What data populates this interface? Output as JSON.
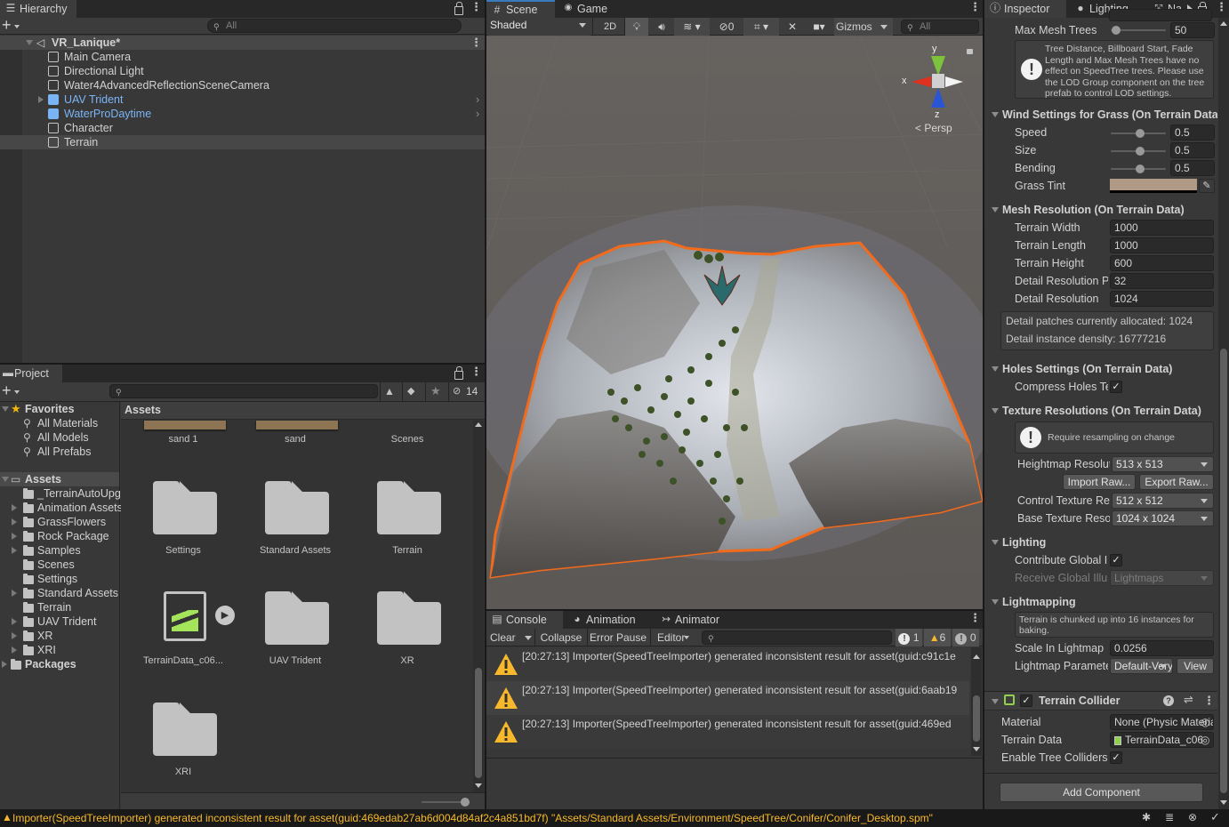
{
  "hierarchy": {
    "tab_label": "Hierarchy",
    "search_placeholder": "All",
    "scene_name": "VR_Lanique*",
    "items": [
      {
        "label": "Main Camera",
        "prefab": false,
        "expandable": false
      },
      {
        "label": "Directional Light",
        "prefab": false,
        "expandable": false
      },
      {
        "label": "Water4AdvancedReflectionSceneCamera",
        "prefab": false,
        "expandable": false
      },
      {
        "label": "UAV Trident",
        "prefab": true,
        "expandable": true
      },
      {
        "label": "WaterProDaytime",
        "prefab": true,
        "expandable": false
      },
      {
        "label": "Character",
        "prefab": false,
        "expandable": false
      },
      {
        "label": "Terrain",
        "prefab": false,
        "expandable": false,
        "selected": true
      }
    ]
  },
  "project": {
    "tab_label": "Project",
    "hidden_count": "14",
    "favorites": {
      "label": "Favorites",
      "items": [
        "All Materials",
        "All Models",
        "All Prefabs"
      ]
    },
    "assets_root": "Assets",
    "folders": [
      {
        "label": "_TerrainAutoUpg",
        "expandable": false
      },
      {
        "label": "Animation Assets",
        "expandable": true
      },
      {
        "label": "GrassFlowers",
        "expandable": true
      },
      {
        "label": "Rock Package",
        "expandable": true
      },
      {
        "label": "Samples",
        "expandable": true
      },
      {
        "label": "Scenes",
        "expandable": false
      },
      {
        "label": "Settings",
        "expandable": false
      },
      {
        "label": "Standard Assets",
        "expandable": true
      },
      {
        "label": "Terrain",
        "expandable": false
      },
      {
        "label": "UAV Trident",
        "expandable": true
      },
      {
        "label": "XR",
        "expandable": true
      },
      {
        "label": "XRI",
        "expandable": true
      }
    ],
    "packages_label": "Packages",
    "breadcrumb": "Assets",
    "grid_items": [
      {
        "label": "sand 1",
        "type": "texture"
      },
      {
        "label": "sand",
        "type": "texture"
      },
      {
        "label": "Scenes",
        "type": "folder"
      },
      {
        "label": "Settings",
        "type": "folder"
      },
      {
        "label": "Standard Assets",
        "type": "folder"
      },
      {
        "label": "Terrain",
        "type": "folder"
      },
      {
        "label": "TerrainData_c06...",
        "type": "terraindata"
      },
      {
        "label": "UAV Trident",
        "type": "folder"
      },
      {
        "label": "XR",
        "type": "folder"
      },
      {
        "label": "XRI",
        "type": "folder"
      }
    ]
  },
  "scene": {
    "tabs": [
      {
        "label": "Scene"
      },
      {
        "label": "Game"
      }
    ],
    "shading_mode": "Shaded",
    "btn_2d": "2D",
    "hidden_count": "0",
    "gizmos_label": "Gizmos",
    "search_placeholder": "All",
    "gizmo": {
      "x": "x",
      "y": "y",
      "z": "z",
      "projection": "Persp"
    }
  },
  "console": {
    "tabs": [
      {
        "label": "Console"
      },
      {
        "label": "Animation"
      },
      {
        "label": "Animator"
      }
    ],
    "clear_label": "Clear",
    "collapse_label": "Collapse",
    "error_pause_label": "Error Pause",
    "editor_label": "Editor",
    "info_count": "1",
    "warning_count": "6",
    "error_count": "0",
    "messages": [
      "[20:27:13] Importer(SpeedTreeImporter) generated inconsistent result for asset(guid:c91c1e",
      "[20:27:13] Importer(SpeedTreeImporter) generated inconsistent result for asset(guid:6aab19",
      "[20:27:13] Importer(SpeedTreeImporter) generated inconsistent result for asset(guid:469ed"
    ]
  },
  "inspector": {
    "tabs": [
      {
        "label": "Inspector"
      },
      {
        "label": "Lighting"
      },
      {
        "label": "Na"
      }
    ],
    "max_mesh_trees": {
      "label": "Max Mesh Trees",
      "value": "50",
      "slider_fraction": 0.025
    },
    "tree_help": "Tree Distance, Billboard Start, Fade Length and Max Mesh Trees have no effect on SpeedTree trees. Please use the LOD Group component on the tree prefab to control LOD settings.",
    "wind": {
      "title": "Wind Settings for Grass (On Terrain Data)",
      "speed": {
        "label": "Speed",
        "value": "0.5",
        "slider_fraction": 0.5
      },
      "size": {
        "label": "Size",
        "value": "0.5",
        "slider_fraction": 0.5
      },
      "bending": {
        "label": "Bending",
        "value": "0.5",
        "slider_fraction": 0.5
      },
      "grass_tint": {
        "label": "Grass Tint",
        "color": "#b09a86"
      }
    },
    "mesh": {
      "title": "Mesh Resolution (On Terrain Data)",
      "fields": [
        {
          "label": "Terrain Width",
          "value": "1000"
        },
        {
          "label": "Terrain Length",
          "value": "1000"
        },
        {
          "label": "Terrain Height",
          "value": "600"
        },
        {
          "label": "Detail Resolution Per Patch",
          "value": "32"
        },
        {
          "label": "Detail Resolution",
          "value": "1024"
        }
      ],
      "info_line1": "Detail patches currently allocated: 1024",
      "info_line2": "Detail instance density: 16777216"
    },
    "holes": {
      "title": "Holes Settings (On Terrain Data)",
      "compress_label": "Compress Holes Texture",
      "compress_checked": true
    },
    "texture": {
      "title": "Texture Resolutions (On Terrain Data)",
      "help": "Require resampling on change",
      "heightmap_label": "Heightmap Resolution",
      "heightmap_value": "513 x 513",
      "import_raw": "Import Raw...",
      "export_raw": "Export Raw...",
      "control_label": "Control Texture Resolution",
      "control_value": "512 x 512",
      "base_label": "Base Texture Resolution",
      "base_value": "1024 x 1024"
    },
    "lighting": {
      "title": "Lighting",
      "contribute_label": "Contribute Global Illumination",
      "contribute_checked": true,
      "receive_label": "Receive Global Illumination",
      "receive_value": "Lightmaps"
    },
    "lightmapping": {
      "title": "Lightmapping",
      "help": "Terrain is chunked up into 16 instances for baking.",
      "scale_label": "Scale In Lightmap",
      "scale_value": "0.0256",
      "params_label": "Lightmap Parameters",
      "params_value": "Default-VeryLowResolution",
      "view_label": "View"
    },
    "collider": {
      "title": "Terrain Collider",
      "enabled": true,
      "material_label": "Material",
      "material_value": "None (Physic Material)",
      "terrain_data_label": "Terrain Data",
      "terrain_data_value": "TerrainData_c06",
      "tree_colliders_label": "Enable Tree Colliders",
      "tree_colliders_checked": true
    },
    "add_component": "Add Component"
  },
  "status_bar": {
    "message": "Importer(SpeedTreeImporter) generated inconsistent result for asset(guid:469edab27ab6d004d84af2c4a851bd7f) \"Assets/Standard Assets/Environment/SpeedTree/Conifer/Conifer_Desktop.spm\""
  },
  "colors": {
    "accent_blue": "#3a79bb",
    "prefab_text": "#7bb4f5",
    "selection_outline": "#f26b1d",
    "warning_yellow": "#f7b92b"
  }
}
